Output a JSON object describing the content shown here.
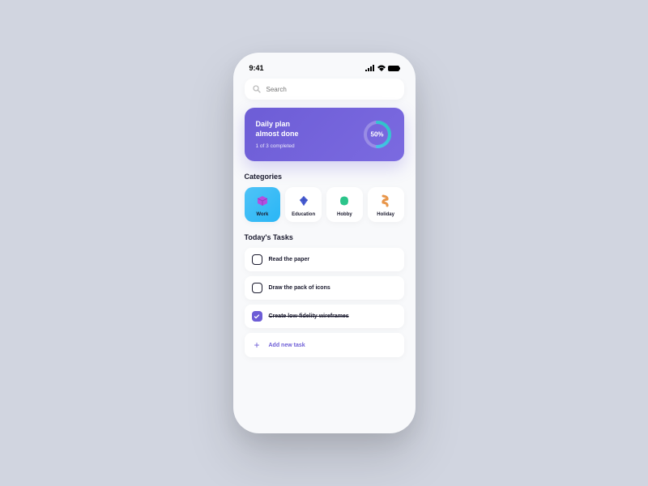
{
  "status": {
    "time": "9:41"
  },
  "search": {
    "placeholder": "Search"
  },
  "daily": {
    "title_line1": "Daily plan",
    "title_line2": "almost done",
    "subtitle": "1 of 3 completed",
    "progress_label": "50%",
    "progress_value": 50
  },
  "sections": {
    "categories": "Categories",
    "tasks": "Today's Tasks"
  },
  "categories": [
    {
      "label": "Work",
      "active": true,
      "color": "#b34fe0"
    },
    {
      "label": "Education",
      "active": false,
      "color": "#4a5fd6"
    },
    {
      "label": "Hobby",
      "active": false,
      "color": "#2bc48a"
    },
    {
      "label": "Holiday",
      "active": false,
      "color": "#e8964a"
    }
  ],
  "tasks": [
    {
      "label": "Read the paper",
      "done": false
    },
    {
      "label": "Draw the pack of icons",
      "done": false
    },
    {
      "label": "Create low-fidelity wireframes",
      "done": true
    }
  ],
  "add_task": {
    "label": "Add new task"
  },
  "colors": {
    "accent": "#6d5dd6",
    "ring_start": "#4fc3f7",
    "ring_end": "#7b6ae0"
  }
}
